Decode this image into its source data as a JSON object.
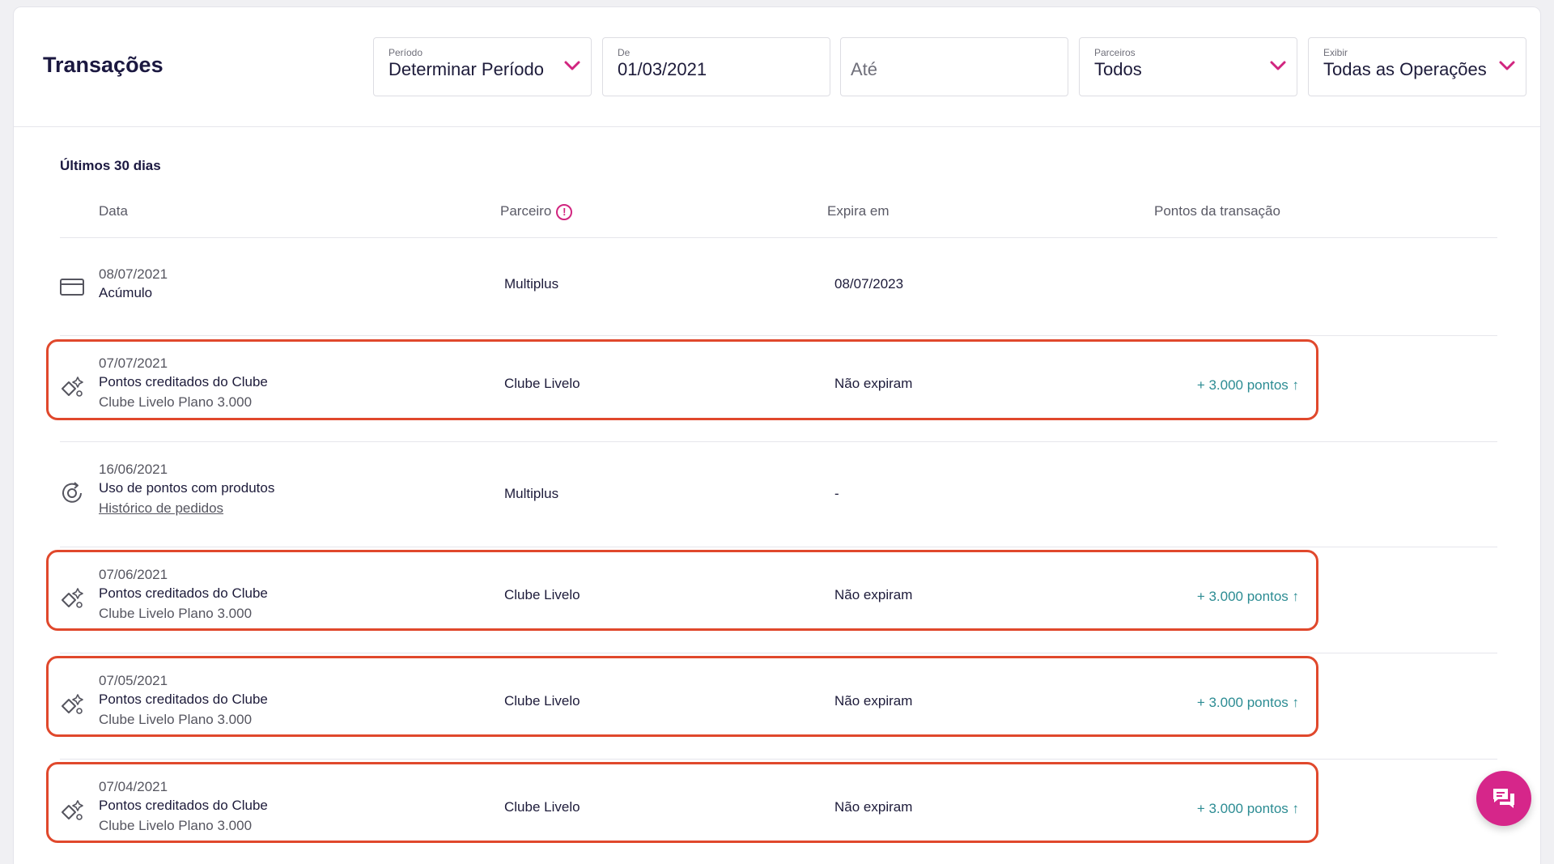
{
  "header": {
    "title": "Transações",
    "filters": {
      "period": {
        "label": "Período",
        "value": "Determinar Período"
      },
      "from": {
        "label": "De",
        "value": "01/03/2021"
      },
      "to": {
        "placeholder": "Até"
      },
      "partners": {
        "label": "Parceiros",
        "value": "Todos"
      },
      "show": {
        "label": "Exibir",
        "value": "Todas as Operações"
      }
    }
  },
  "section": {
    "title": "Últimos 30 dias"
  },
  "columns": {
    "date": "Data",
    "partner": "Parceiro",
    "expires": "Expira em",
    "points": "Pontos da transação"
  },
  "rows": [
    {
      "icon": "credit-card-icon",
      "date": "08/07/2021",
      "title": "Acúmulo",
      "subtitle": "",
      "partner": "Multiplus",
      "expires": "08/07/2023",
      "points": "",
      "highlighted": false
    },
    {
      "icon": "sparkle-points-icon",
      "date": "07/07/2021",
      "title": "Pontos creditados do Clube",
      "subtitle": "Clube Livelo Plano 3.000",
      "partner": "Clube Livelo",
      "expires": "Não expiram",
      "points": "+ 3.000 pontos ↑",
      "highlighted": true
    },
    {
      "icon": "points-exchange-icon",
      "date": "16/06/2021",
      "title": "Uso de pontos com produtos",
      "subtitle": "Histórico de pedidos",
      "partner": "Multiplus",
      "expires": "-",
      "points": "",
      "highlighted": false
    },
    {
      "icon": "sparkle-points-icon",
      "date": "07/06/2021",
      "title": "Pontos creditados do Clube",
      "subtitle": "Clube Livelo Plano 3.000",
      "partner": "Clube Livelo",
      "expires": "Não expiram",
      "points": "+ 3.000 pontos ↑",
      "highlighted": true
    },
    {
      "icon": "sparkle-points-icon",
      "date": "07/05/2021",
      "title": "Pontos creditados do Clube",
      "subtitle": "Clube Livelo Plano 3.000",
      "partner": "Clube Livelo",
      "expires": "Não expiram",
      "points": "+ 3.000 pontos ↑",
      "highlighted": true
    },
    {
      "icon": "sparkle-points-icon",
      "date": "07/04/2021",
      "title": "Pontos creditados do Clube",
      "subtitle": "Clube Livelo Plano 3.000",
      "partner": "Clube Livelo",
      "expires": "Não expiram",
      "points": "+ 3.000 pontos ↑",
      "highlighted": true
    }
  ],
  "colors": {
    "accent": "#d1257f",
    "points": "#2c8c93",
    "highlight": "#e0482c",
    "chat": "#d6268a"
  },
  "chat_button": {
    "icon": "chat-icon"
  }
}
